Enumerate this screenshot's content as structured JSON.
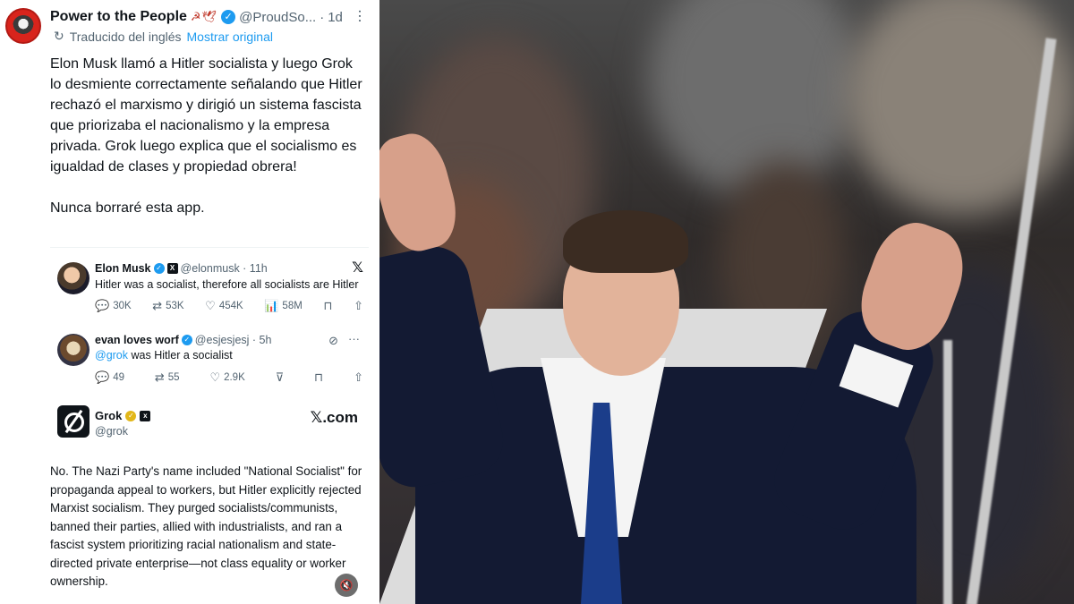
{
  "tweet": {
    "display_name": "Power to the People",
    "name_emoji": "☭🕊",
    "verified_mark": "✓",
    "handle": "@ProudSo...",
    "separator": "·",
    "time": "1d",
    "more_icon": "⋯",
    "translate_icon": "↻",
    "translated_label": "Traducido del inglés",
    "show_original": "Mostrar original",
    "body": "Elon Musk llamó a Hitler socialista y luego Grok lo desmiente correctamente señalando que Hitler rechazó el marxismo y dirigió un sistema fascista que priorizaba el nacionalismo y la empresa privada. Grok luego explica que el socialismo es igualdad de clases y propiedad obrera!\n\nNunca borraré esta app."
  },
  "quoted": {
    "musk": {
      "name": "Elon Musk",
      "badge": "✓",
      "square_badge": "X",
      "handle": "@elonmusk · 11h",
      "text": "Hitler was a socialist, therefore all socialists are Hitler",
      "x_logo": "𝕏",
      "replies": "30K",
      "reposts": "53K",
      "likes": "454K",
      "views": "58M",
      "reply_icon": "💬",
      "repost_icon": "⇄",
      "like_icon": "♡",
      "views_icon": "📊",
      "bookmark_icon": "⊓",
      "share_icon": "⇧"
    },
    "evan": {
      "name": "evan loves worf",
      "badge": "✓",
      "handle": "@esjesjesj · 5h",
      "mention": "@grok",
      "text": " was Hitler a socialist",
      "replies": "49",
      "reposts": "55",
      "likes": "2.9K",
      "grok_icon": "⊘",
      "more_icon": "···",
      "reply_icon": "💬",
      "repost_icon": "⇄",
      "like_icon": "♡",
      "dislike_icon": "⊽",
      "bookmark_icon": "⊓",
      "share_icon": "⇧"
    },
    "grok": {
      "name": "Grok",
      "badge": "✓",
      "square_badge": "x",
      "handle": "@grok",
      "site": "𝕏.com",
      "answer": "No. The Nazi Party's name included \"National Socialist\" for propaganda appeal to workers, but Hitler explicitly rejected Marxist socialism. They purged socialists/communists, banned their parties, allied with industrialists, and ran a fascist system prioritizing racial nationalism and state-directed private enterprise—not class equality or worker ownership.",
      "mute_icon": "🔇"
    }
  },
  "colors": {
    "accent": "#1d9bf0",
    "text": "#0f1419",
    "muted": "#536471",
    "suit": "#131a33",
    "tie": "#1b3d8a"
  }
}
